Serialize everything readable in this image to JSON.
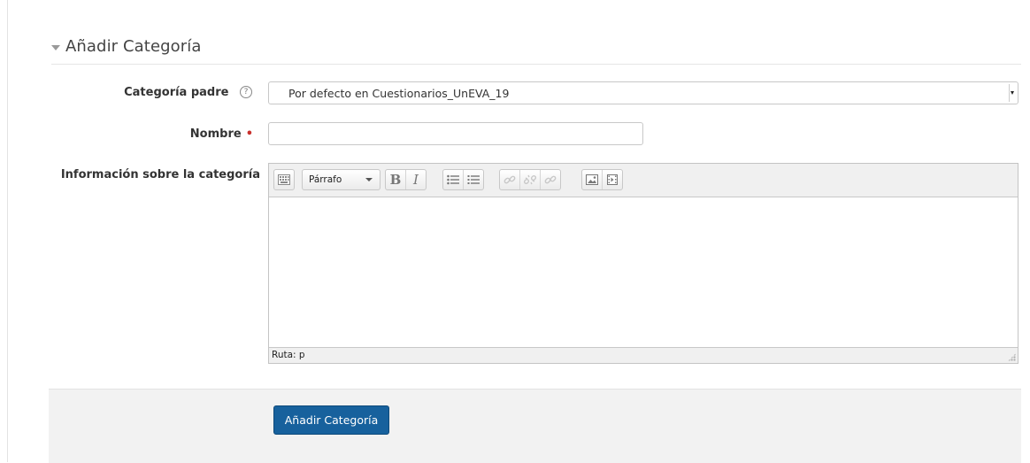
{
  "section": {
    "title": "Añadir Categoría"
  },
  "fields": {
    "parent_category": {
      "label": "Categoría padre",
      "help_icon": "question-circle-icon",
      "value": "Por defecto en Cuestionarios_UnEVA_19"
    },
    "name": {
      "label": "Nombre",
      "required_marker": "•",
      "value": ""
    },
    "info": {
      "label": "Información sobre la categoría"
    }
  },
  "editor": {
    "toolbar": {
      "toggle_icon": "keyboard-toolbar-toggle-icon",
      "format_select": "Párrafo",
      "bold": "B",
      "italic": "I",
      "unordered_list_icon": "unordered-list-icon",
      "ordered_list_icon": "ordered-list-icon",
      "link_icon": "link-icon",
      "unlink_icon": "unlink-icon",
      "anchor_icon": "anchor-link-icon",
      "image_icon": "image-icon",
      "media_icon": "media-icon"
    },
    "status_path": "Ruta: p",
    "content": ""
  },
  "actions": {
    "submit_label": "Añadir Categoría"
  },
  "colors": {
    "primary": "#17619d",
    "required": "#c9302c",
    "footer_bg": "#f2f2f2"
  }
}
